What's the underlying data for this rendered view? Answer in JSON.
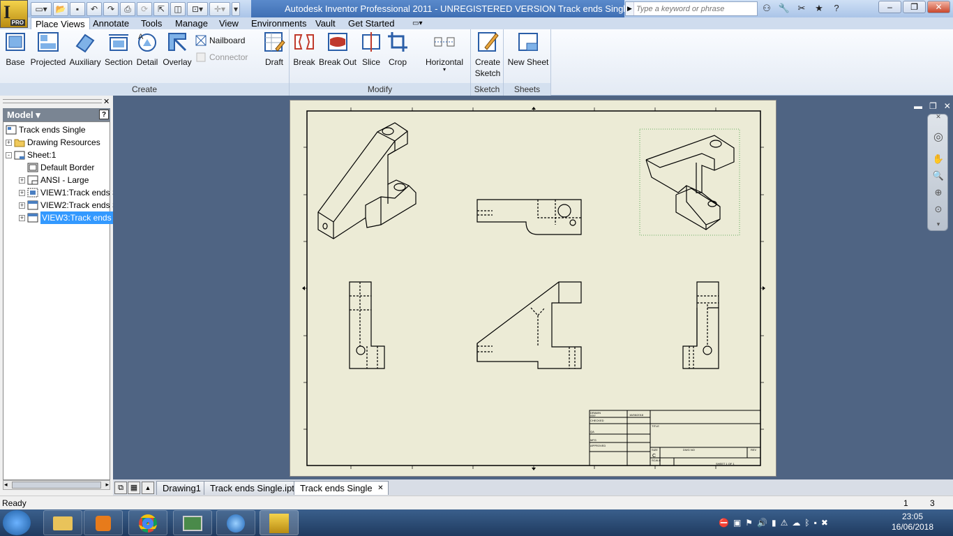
{
  "window": {
    "title": "Autodesk Inventor Professional 2011 - UNREGISTERED VERSION    Track ends Single",
    "app_badge": "PRO",
    "search_placeholder": "Type a keyword or phrase"
  },
  "qat": [
    "new",
    "open",
    "save",
    "undo",
    "redo",
    "print",
    "update",
    "return",
    "measure",
    "more"
  ],
  "ribbon_tabs": [
    "Place Views",
    "Annotate",
    "Tools",
    "Manage",
    "View",
    "Environments",
    "Vault",
    "Get Started"
  ],
  "active_tab": "Place Views",
  "panels": {
    "create": {
      "label": "Create",
      "buttons": [
        "Base",
        "Projected",
        "Auxiliary",
        "Section",
        "Detail",
        "Overlay"
      ],
      "small": [
        {
          "label": "Nailboard",
          "enabled": true
        },
        {
          "label": "Connector",
          "enabled": false
        }
      ]
    },
    "modify": {
      "label": "Modify",
      "buttons": [
        "Draft",
        "Break",
        "Break Out",
        "Slice",
        "Crop",
        "Horizontal"
      ]
    },
    "sketch": {
      "label": "Sketch",
      "buttons": [
        "Create Sketch"
      ],
      "button_lines": [
        "Create",
        "Sketch"
      ]
    },
    "sheets": {
      "label": "Sheets",
      "buttons": [
        "New Sheet"
      ]
    }
  },
  "browser": {
    "header": "Model",
    "help": "?",
    "tree": [
      {
        "label": "Track ends Single",
        "level": 0,
        "expander": "",
        "icon": "drawing-icon"
      },
      {
        "label": "Drawing Resources",
        "level": 0,
        "expander": "+",
        "icon": "folder-icon"
      },
      {
        "label": "Sheet:1",
        "level": 0,
        "expander": "-",
        "icon": "sheet-icon"
      },
      {
        "label": "Default Border",
        "level": 1,
        "expander": "",
        "icon": "border-icon"
      },
      {
        "label": "ANSI - Large",
        "level": 1,
        "expander": "+",
        "icon": "titleblock-icon"
      },
      {
        "label": "VIEW1:Track ends S",
        "level": 1,
        "expander": "+",
        "icon": "view-icon"
      },
      {
        "label": "VIEW2:Track ends S",
        "level": 1,
        "expander": "+",
        "icon": "view-icon"
      },
      {
        "label": "VIEW3:Track ends S",
        "level": 1,
        "expander": "+",
        "icon": "view-icon",
        "selected": true
      }
    ]
  },
  "title_block": {
    "date": "16/06/2018",
    "title": "TITLE",
    "size": "SIZE",
    "size_value": "C",
    "dwg_no": "DWG NO",
    "rev": "REV",
    "scale": "SCALE",
    "sheet": "SHEET 1  OF 1",
    "drawn": "DRAWN",
    "checked": "CHECKED",
    "qa": "QA",
    "mfg": "MFG",
    "approved": "APPROVED",
    "user": "user"
  },
  "document_tabs": [
    "Drawing1",
    "Track ends Single.ipt",
    "Track ends Single"
  ],
  "active_document": "Track ends Single",
  "status": {
    "text": "Ready",
    "left_number": "1",
    "right_number": "3"
  },
  "clock": {
    "time": "23:05",
    "date": "16/06/2018"
  },
  "colors": {
    "accent": "#3f6fb4",
    "workspace": "#4f6483",
    "sheet": "#ecebd6",
    "selection": "#3399ff"
  }
}
